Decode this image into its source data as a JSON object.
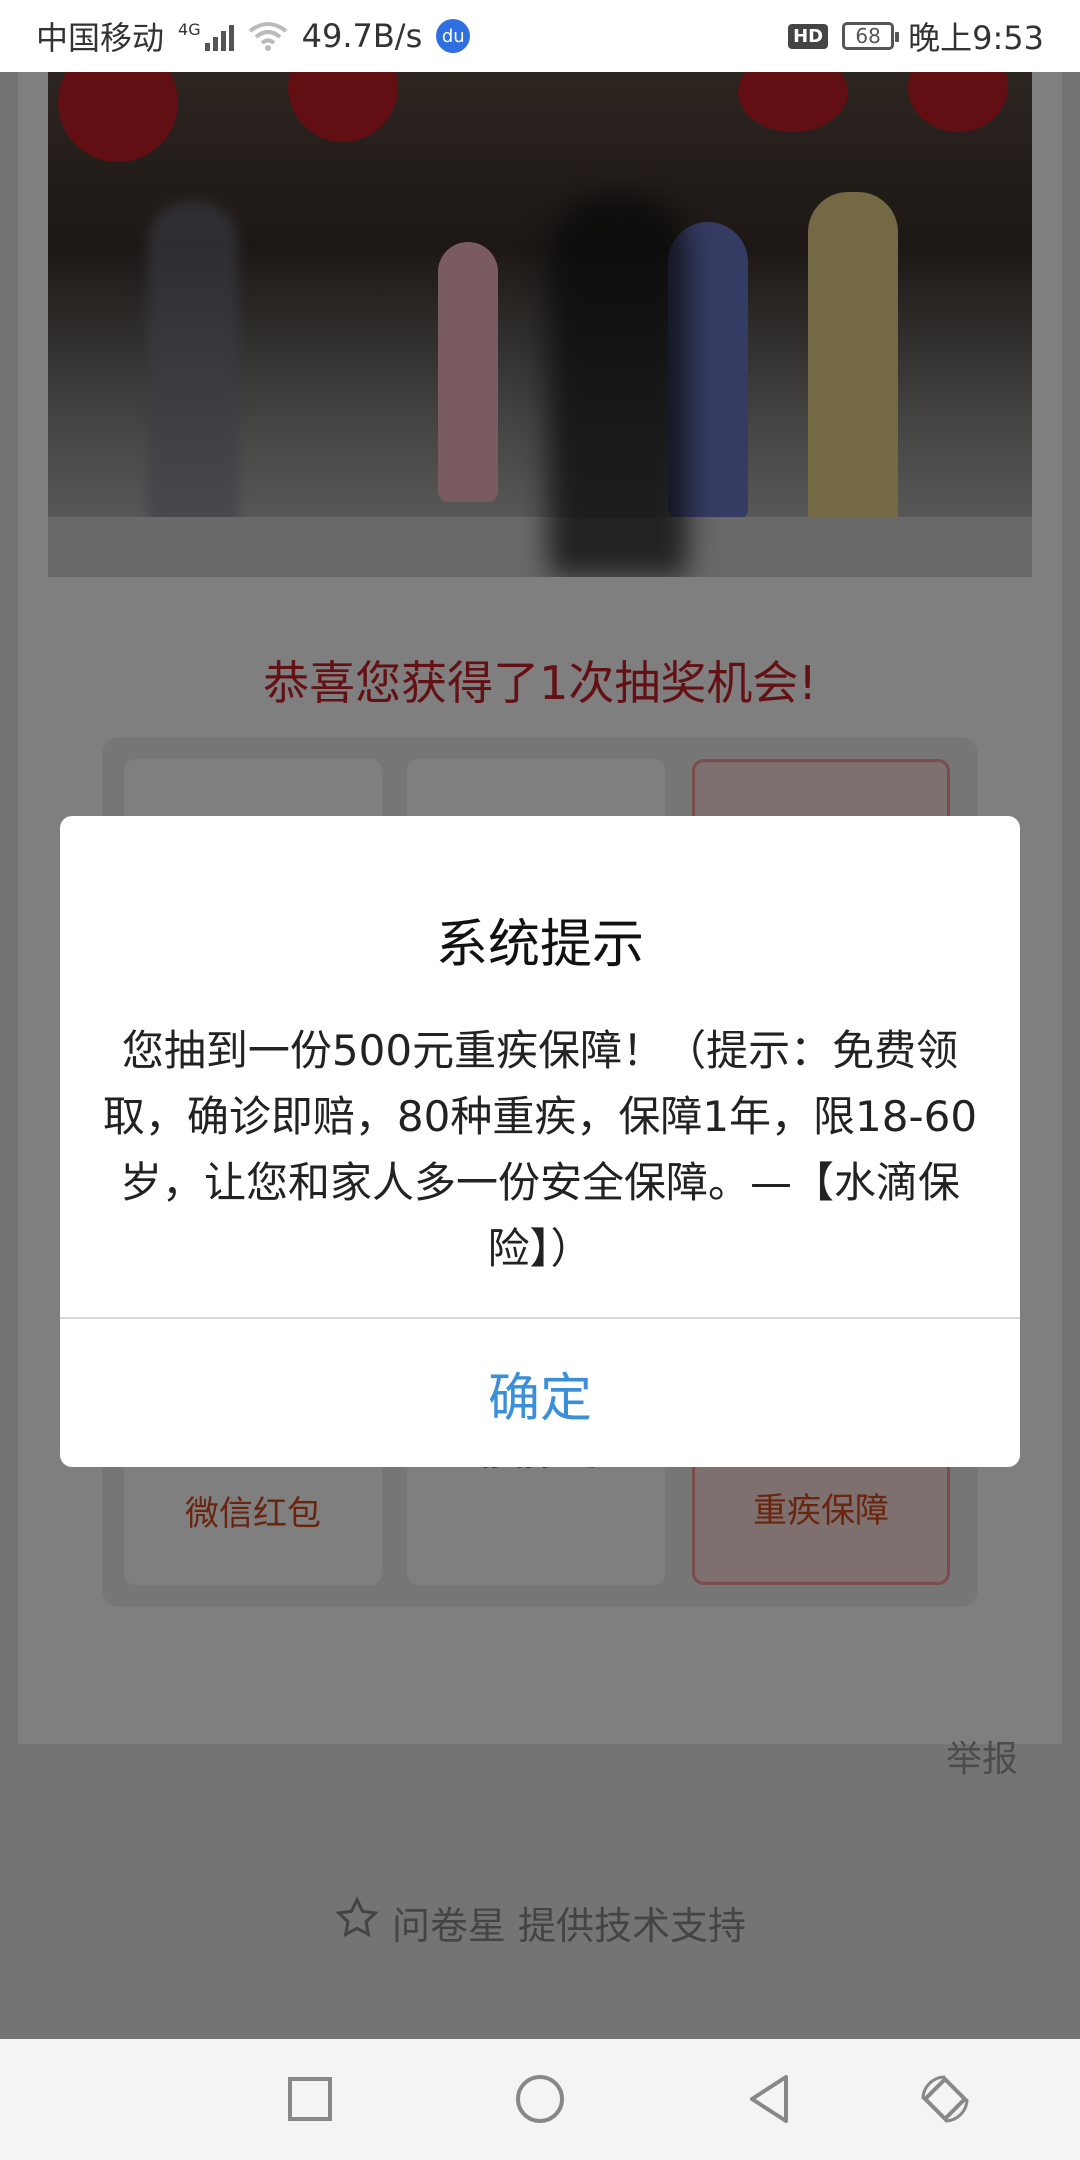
{
  "status_bar": {
    "carrier": "中国移动",
    "network": "4G",
    "speed": "49.7B/s",
    "hd": "HD",
    "battery": "68",
    "time": "晚上9:53"
  },
  "page": {
    "prize_title": "恭喜您获得了1次抽奖机会!",
    "grid_cells": [
      {
        "label": "微信红包"
      },
      {
        "label": "谢谢参与"
      },
      {
        "label": "重疾保障"
      }
    ],
    "report": "举报",
    "support": "问卷星 提供技术支持"
  },
  "dialog": {
    "title": "系统提示",
    "message": "您抽到一份500元重疾保障！（提示：免费领取，确诊即赔，80种重疾，保障1年，限18-60岁，让您和家人多一份安全保障。—【水滴保险】）",
    "ok_label": "确定"
  },
  "icons": {
    "star": "star-icon",
    "nav_square": "recent-apps-icon",
    "nav_circle": "home-icon",
    "nav_triangle": "back-icon",
    "nav_rotate": "rotate-icon"
  },
  "colors": {
    "prize_title": "#c8232b",
    "cell_text": "#d44a1f",
    "ok_button": "#3a8fd8"
  }
}
